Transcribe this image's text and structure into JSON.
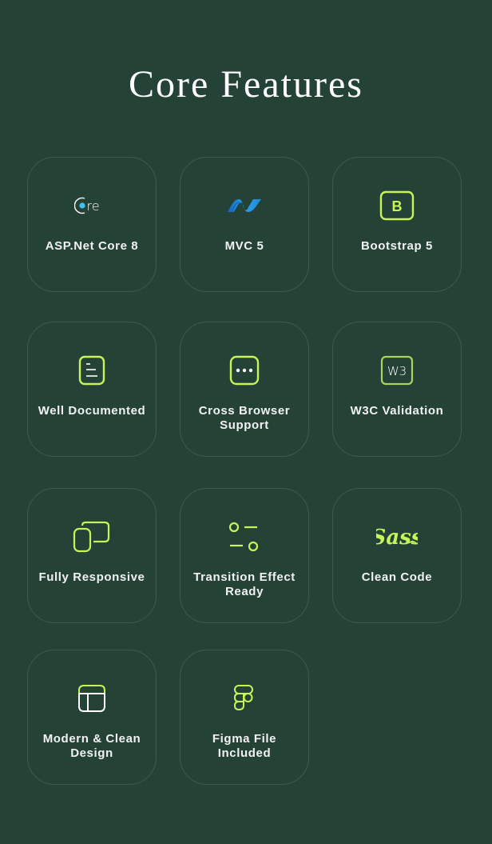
{
  "header": {
    "title": "Core Features"
  },
  "colors": {
    "background": "#254237",
    "card_border": "#3f5b50",
    "accent": "#c7f45a",
    "text": "#f2f2f2",
    "dotnet_blue": "#1e88d8",
    "core_dot": "#3cc6f0"
  },
  "features": [
    {
      "label": "ASP.Net Core 8",
      "icon": "asp-net-core-logo-icon"
    },
    {
      "label": "MVC 5",
      "icon": "dotnet-logo-icon"
    },
    {
      "label": "Bootstrap 5",
      "icon": "bootstrap-logo-icon"
    },
    {
      "label": "Well Documented",
      "icon": "document-icon"
    },
    {
      "label": "Cross Browser Support",
      "icon": "browser-dots-icon"
    },
    {
      "label": "W3C Validation",
      "icon": "w3c-icon",
      "icon_text": "W3"
    },
    {
      "label": "Fully Responsive",
      "icon": "responsive-devices-icon"
    },
    {
      "label": "Transition Effect Ready",
      "icon": "toggle-settings-icon"
    },
    {
      "label": "Clean Code",
      "icon": "sass-logo-icon"
    },
    {
      "label": "Modern & Clean Design",
      "icon": "layout-icon"
    },
    {
      "label": "Figma File Included",
      "icon": "figma-logo-icon"
    }
  ]
}
